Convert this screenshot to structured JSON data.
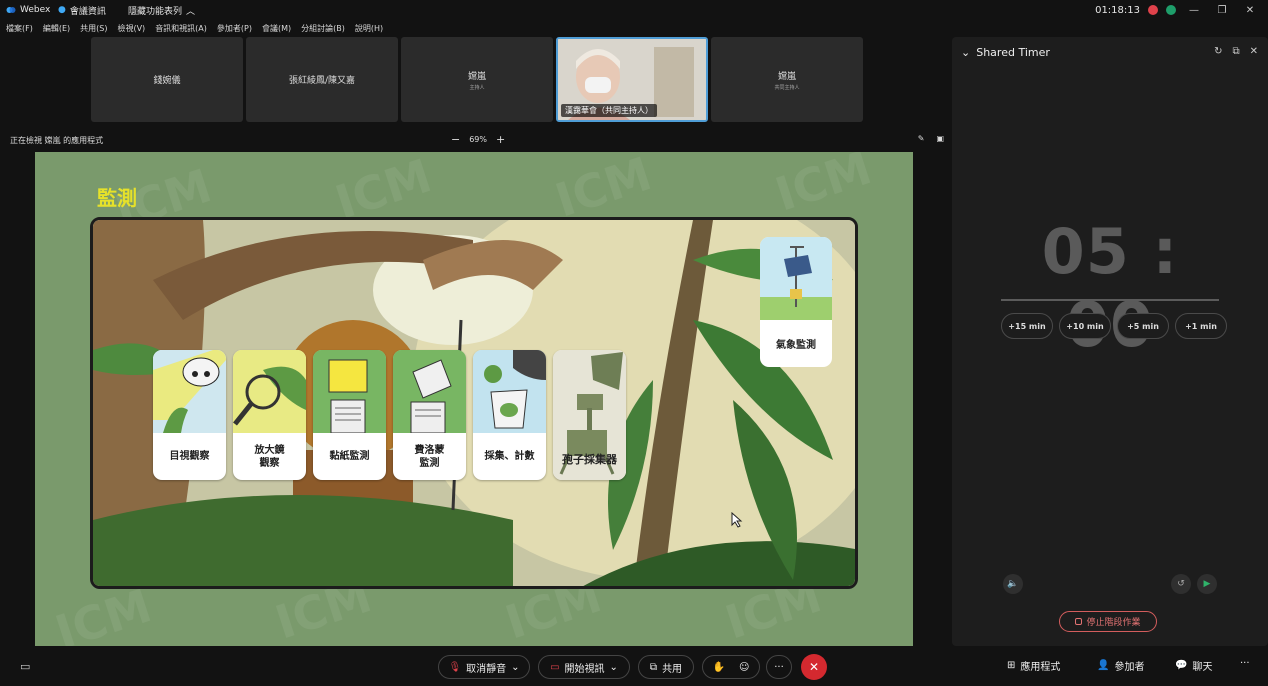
{
  "titlebar": {
    "app_name": "Webex",
    "meeting_info": "會議資訊",
    "hidden_menu": "隱藏功能表列",
    "clock": "01:18:13"
  },
  "menubar": [
    "檔案(F)",
    "編輯(E)",
    "共用(S)",
    "檢視(V)",
    "音訊和視訊(A)",
    "參加者(P)",
    "會議(M)",
    "分組討論(B)",
    "說明(H)"
  ],
  "participants": [
    {
      "name": "錢婉儀",
      "role": ""
    },
    {
      "name": "張紅綾鳳/陳又嘉",
      "role": ""
    },
    {
      "name": "嫦嵐",
      "role": "主持人"
    },
    {
      "name": "漢靄華會（共同主持人）",
      "role": ""
    },
    {
      "name": "嫦嵐",
      "role": "共同主持人"
    }
  ],
  "viewbar": {
    "label": "正在檢視 嫦嵐 的應用程式",
    "zoom": "69%",
    "minus": "−",
    "plus": "+"
  },
  "slide": {
    "title": "監測",
    "watermark": "ICM",
    "cards": [
      "目視觀察",
      "放大鏡\n觀察",
      "黏紙監測",
      "費洛蒙\n監測",
      "採集、計數",
      "孢子採集器"
    ],
    "weather_card": "氣象監測"
  },
  "timer_panel": {
    "title": "Shared Timer",
    "time": "05 : 00",
    "presets": [
      "+15 min",
      "+10 min",
      "+5 min",
      "+1 min"
    ],
    "stop_label": "停止階段作業"
  },
  "bottombar": {
    "unmute": "取消靜音",
    "start_video": "開始視訊",
    "share": "共用",
    "more": "···",
    "apps": "應用程式",
    "participants": "參加者",
    "chat": "聊天"
  },
  "colors": {
    "accent_blue": "#4f9dd6",
    "end_red": "#d4292f",
    "slide_green": "#7a9a6c",
    "title_yellow": "#e6e12a"
  }
}
